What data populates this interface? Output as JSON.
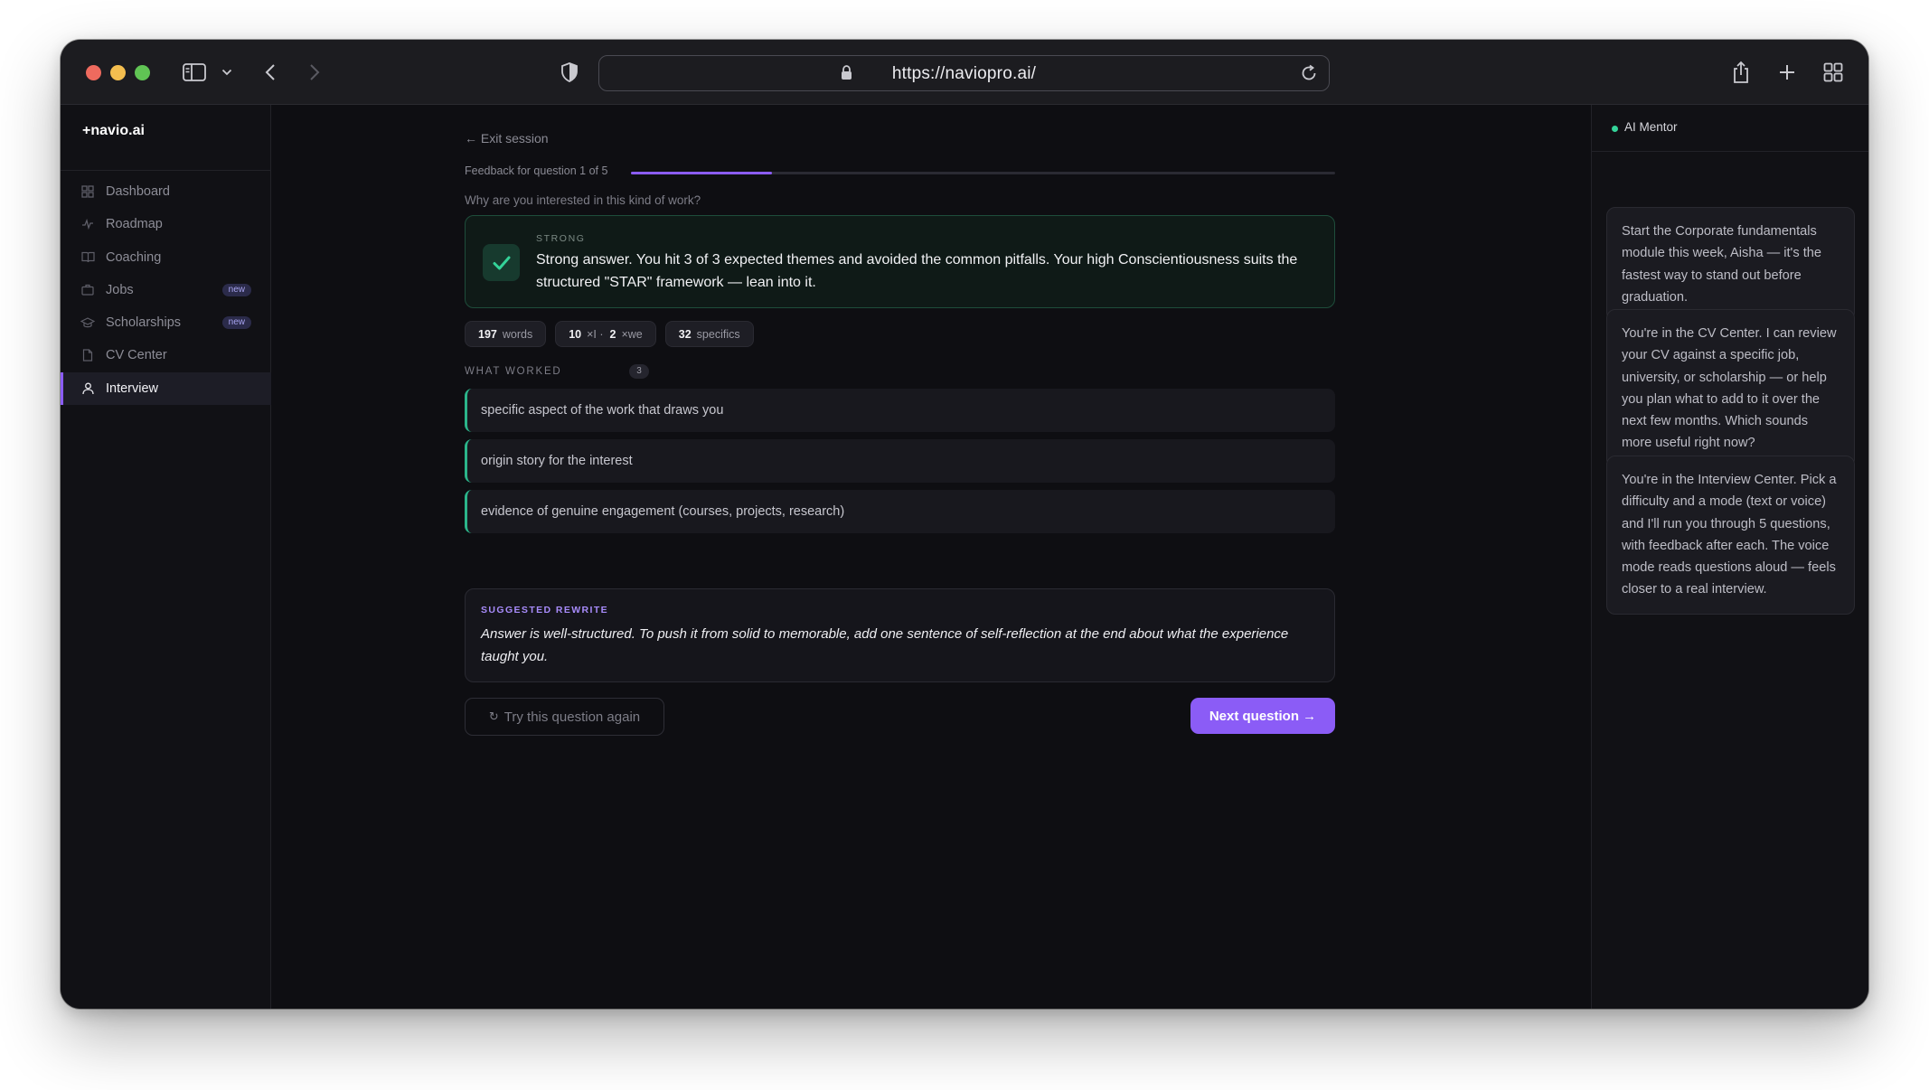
{
  "browser": {
    "url": "https://naviopro.ai/"
  },
  "sidebar": {
    "brand": "+navio.ai",
    "items": [
      {
        "label": "Dashboard",
        "icon": "grid-icon"
      },
      {
        "label": "Roadmap",
        "icon": "pulse-icon"
      },
      {
        "label": "Coaching",
        "icon": "book-icon"
      },
      {
        "label": "Jobs",
        "icon": "briefcase-icon",
        "badge": "new"
      },
      {
        "label": "Scholarships",
        "icon": "graduation-cap-icon",
        "badge": "new"
      },
      {
        "label": "CV Center",
        "icon": "document-icon"
      },
      {
        "label": "Interview",
        "icon": "user-icon",
        "active": true
      }
    ]
  },
  "session": {
    "exit_label": "← Exit session",
    "progress_label": "Feedback for question 1 of 5",
    "progress_fraction": 0.2,
    "question": "Why are you interested in this kind of work?",
    "verdict": {
      "tag": "STRONG",
      "text": "Strong answer. You hit 3 of 3 expected themes and avoided the common pitfalls. Your high Conscientiousness suits the structured \"STAR\" framework — lean into it."
    },
    "stats": [
      {
        "value": "197",
        "label": "words"
      },
      {
        "value": "10",
        "label": "×I ·"
      },
      {
        "value": "2",
        "label": "×we"
      },
      {
        "value": "32",
        "label": "specifics"
      }
    ],
    "what_worked": {
      "label": "WHAT WORKED",
      "count": "3",
      "items": [
        "specific aspect of the work that draws you",
        "origin story for the interest",
        "evidence of genuine engagement (courses, projects, research)"
      ]
    },
    "rewrite": {
      "tag": "SUGGESTED REWRITE",
      "text": "Answer is well-structured. To push it from solid to memorable, add one sentence of self-reflection at the end about what the experience taught you."
    },
    "retry_label": "Try this question again",
    "retry_icon": "↻",
    "next_label": "Next question →"
  },
  "mentor": {
    "title": "AI Mentor",
    "messages": [
      "Start the Corporate fundamentals module this week, Aisha — it's the fastest way to stand out before graduation.",
      "You're in the CV Center. I can review your CV against a specific job, university, or scholarship — or help you plan what to add to it over the next few months. Which sounds more useful right now?",
      "You're in the Interview Center. Pick a difficulty and a mode (text or voice) and I'll run you through 5 questions, with feedback after each. The voice mode reads questions aloud — feels closer to a real interview."
    ]
  },
  "colors": {
    "accent": "#8b5cf6",
    "success": "#34d399",
    "background": "#0e0e12"
  }
}
